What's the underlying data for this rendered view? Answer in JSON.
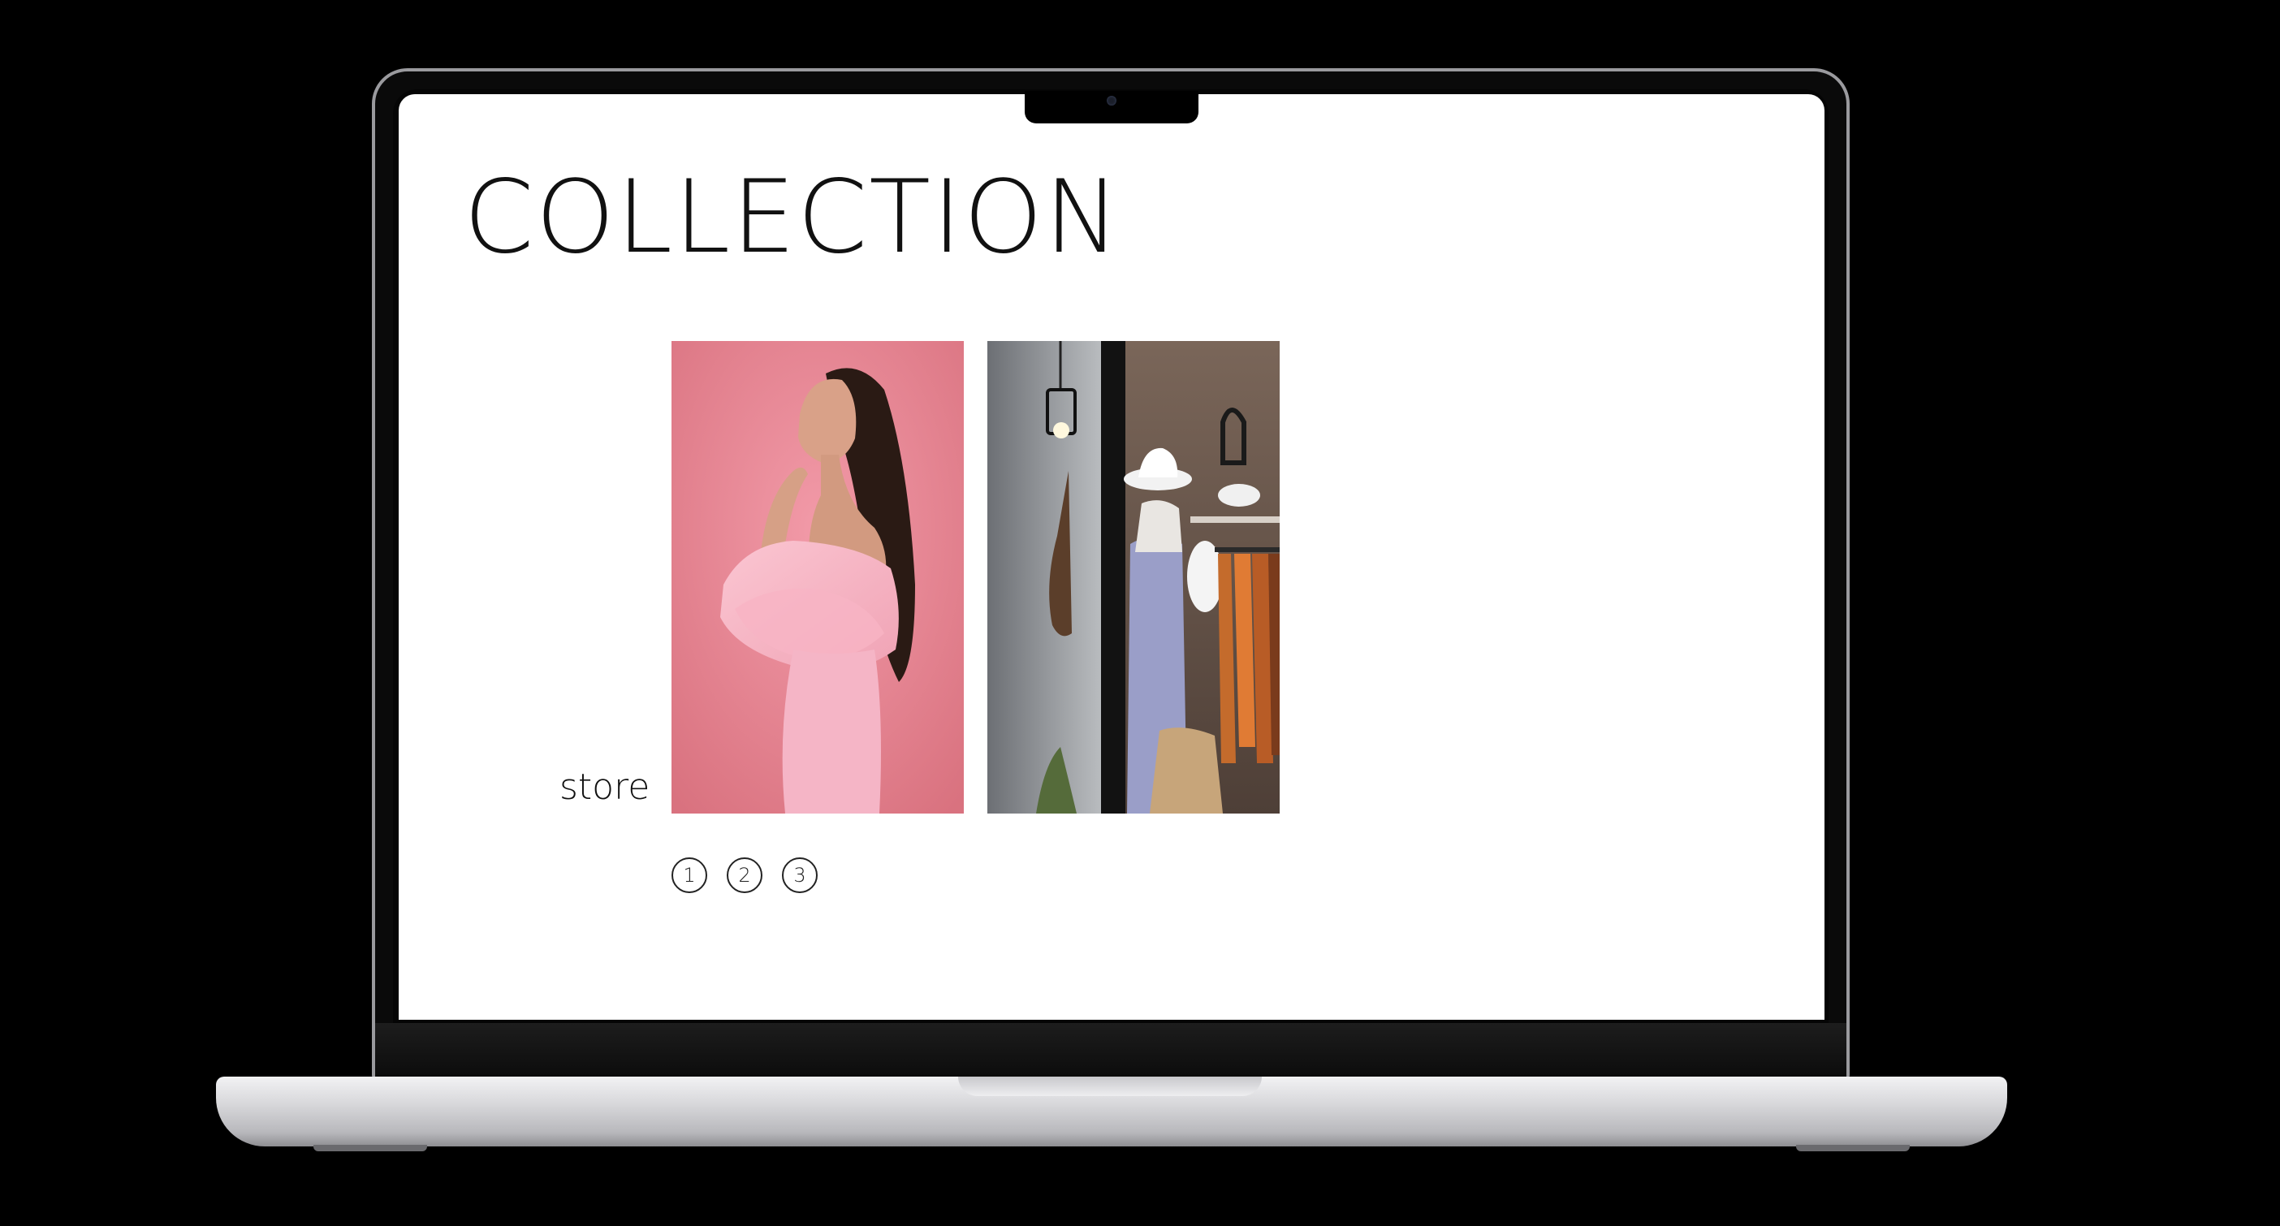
{
  "page": {
    "title": "COLLECTION",
    "store_label": "store"
  },
  "gallery": {
    "items": [
      {
        "alt": "woman in pink off-shoulder ruffle dress against pink background"
      },
      {
        "alt": "boutique storefront window with hanging lamp, hats and clothing rack"
      }
    ]
  },
  "pagination": {
    "pages": [
      "1",
      "2",
      "3"
    ]
  },
  "colors": {
    "background": "#000000",
    "screen": "#ffffff",
    "text": "#111111",
    "photo_pink": "#e88a9a",
    "photo_store": "#5b4c44"
  }
}
